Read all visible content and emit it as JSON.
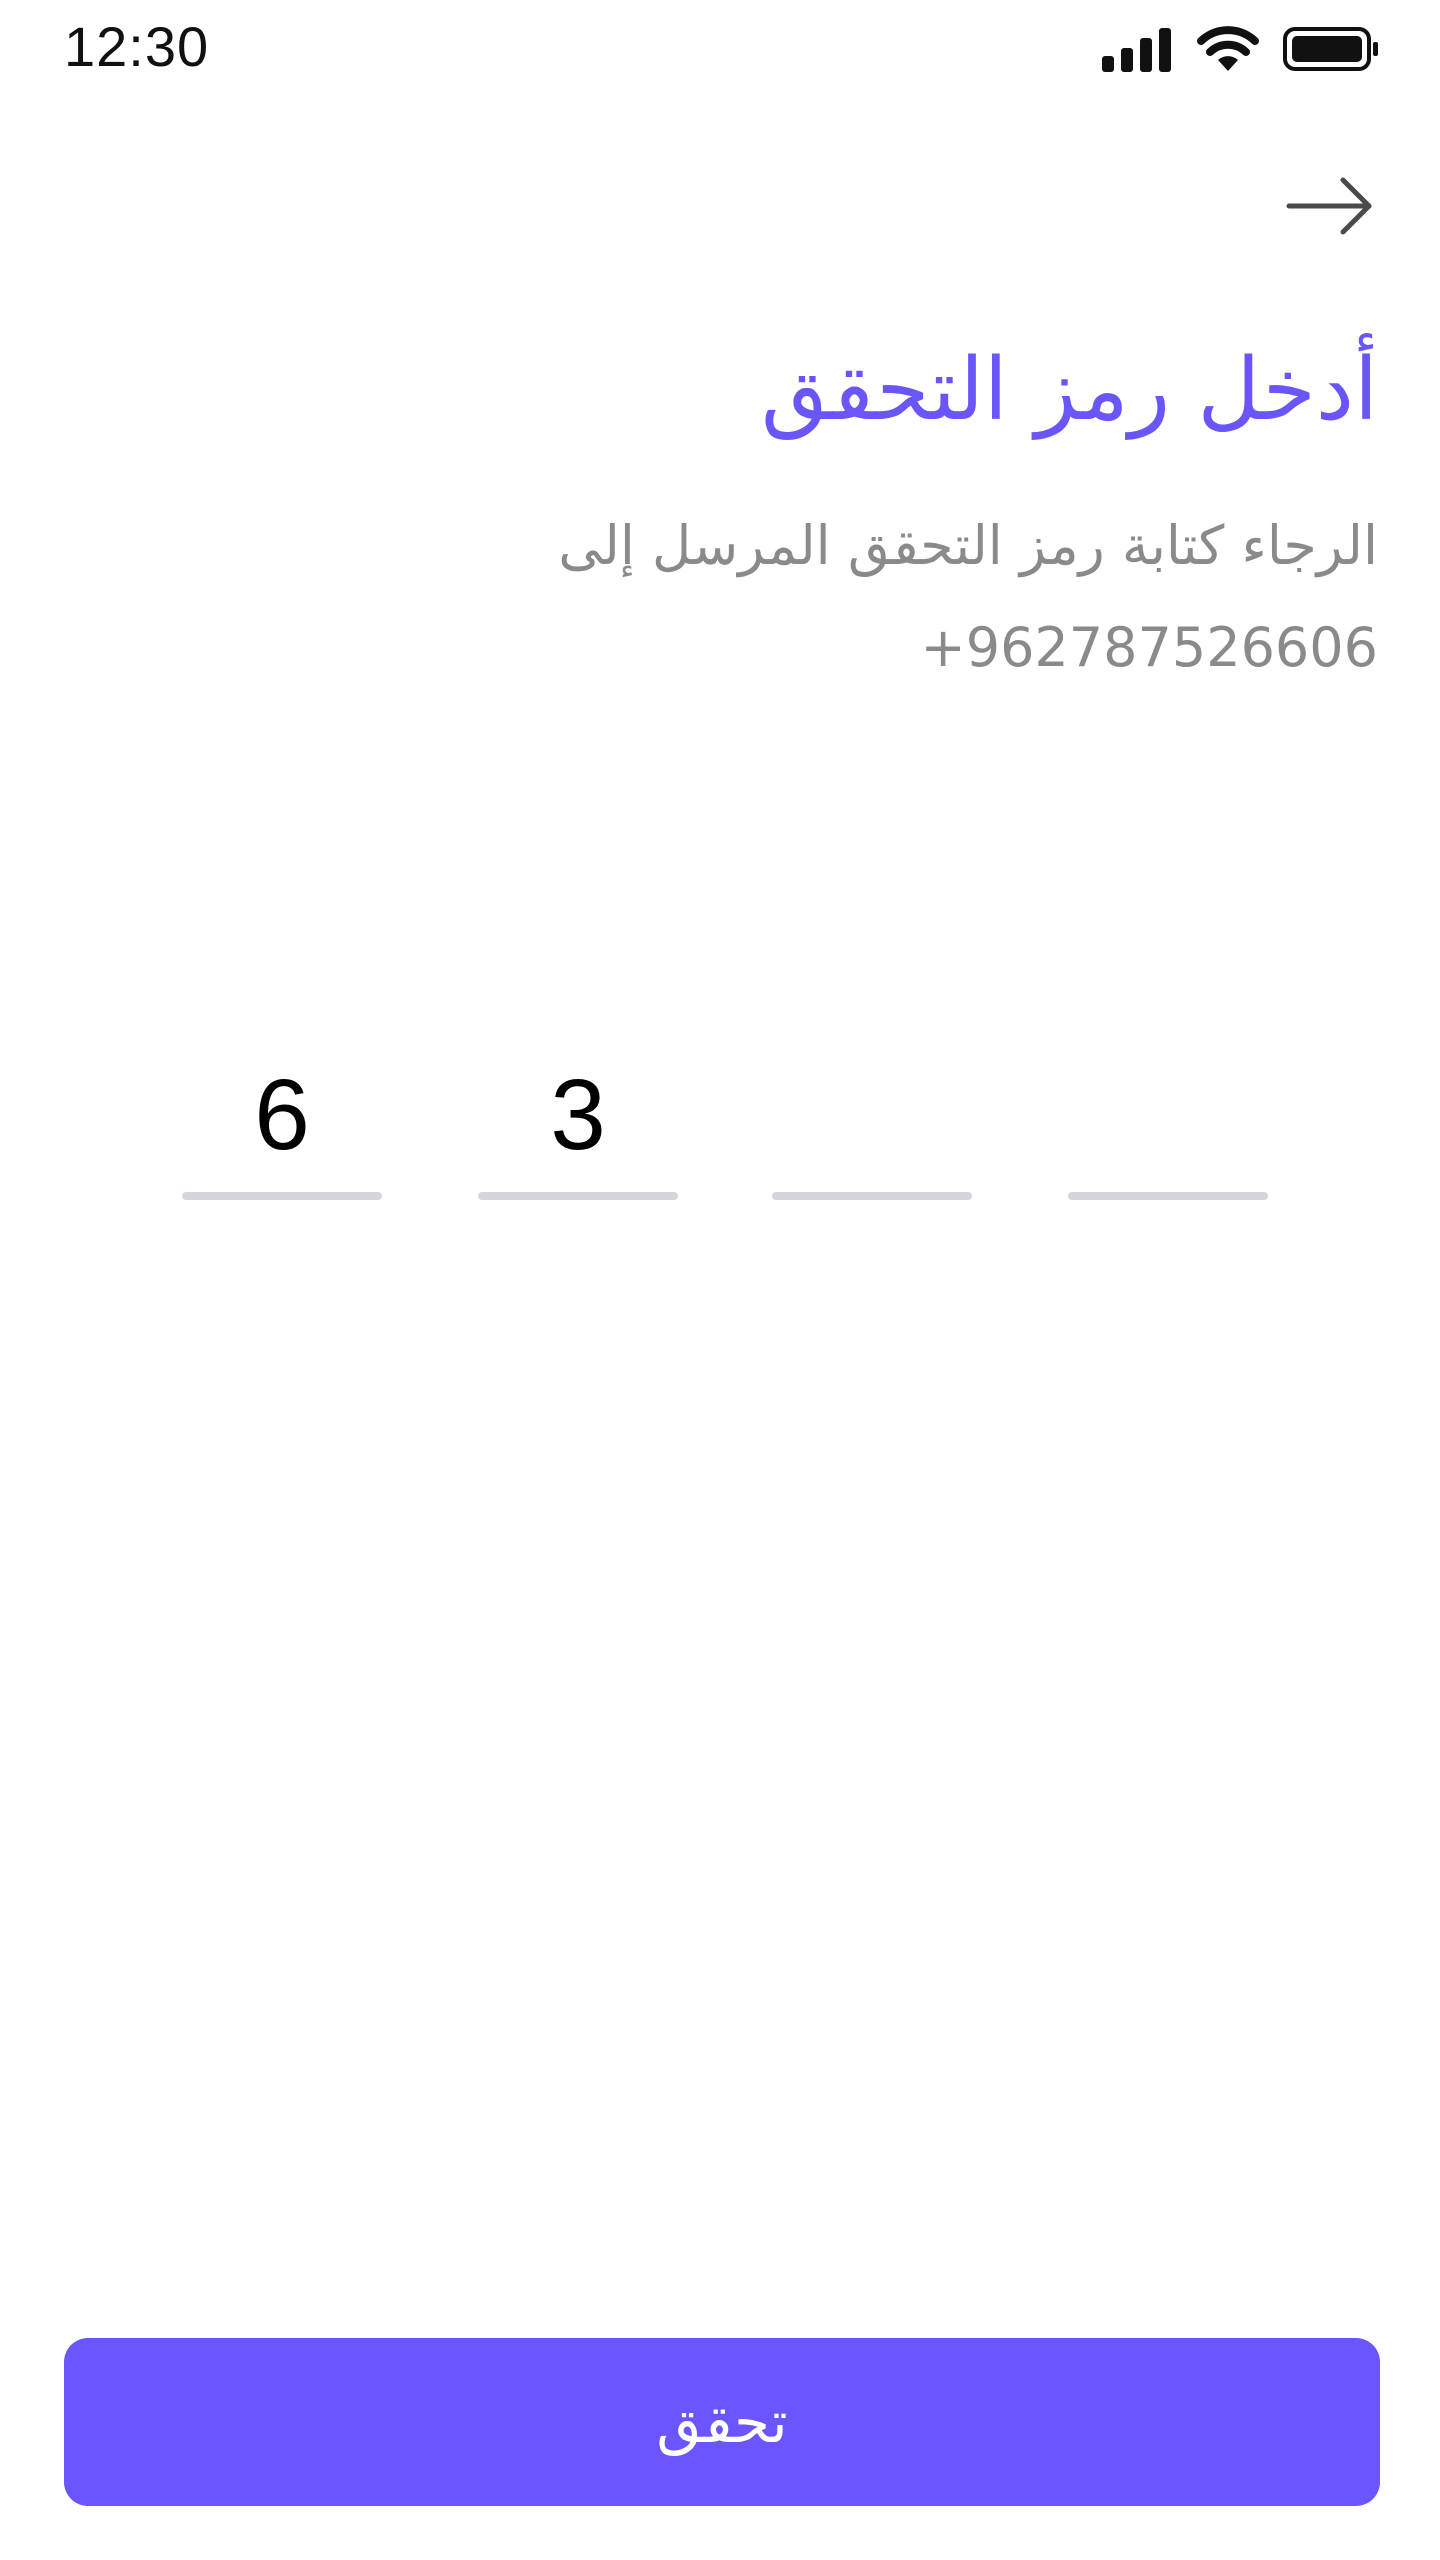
{
  "status_bar": {
    "time": "12:30",
    "icons": [
      "signal-icon",
      "wifi-icon",
      "battery-icon"
    ]
  },
  "header": {
    "back_icon": "arrow-right-icon"
  },
  "content": {
    "title": "أدخل رمز التحقق",
    "subtitle": "الرجاء كتابة رمز التحقق المرسل إلى",
    "phone": "+962787526606"
  },
  "otp": {
    "digits": [
      "6",
      "3",
      "",
      ""
    ]
  },
  "actions": {
    "verify_label": "تحقق"
  },
  "colors": {
    "accent": "#6a55ff",
    "title": "#6a55f8",
    "secondary_text": "#8a8a8a",
    "otp_underline": "#d3d6db"
  }
}
